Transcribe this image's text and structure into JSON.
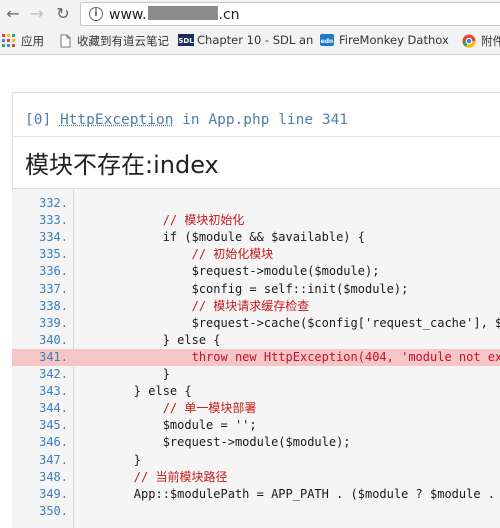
{
  "browser": {
    "url_prefix": "www.",
    "url_suffix": ".cn",
    "bookmarks": [
      {
        "label": "应用",
        "icon": "apps-grid-icon"
      },
      {
        "label": "收藏到有道云笔记",
        "icon": "page-icon"
      },
      {
        "label": "Chapter 10 - SDL an",
        "icon": "sdl-icon"
      },
      {
        "label": "FireMonkey Dathox",
        "icon": "edn-icon"
      },
      {
        "label": "附件",
        "icon": "chrome-icon"
      }
    ]
  },
  "exception": {
    "index": "[0]",
    "class": "HttpException",
    "location": "in App.php line 341",
    "message": "模块不存在:index"
  },
  "code_lines": [
    {
      "n": "332.",
      "text": ""
    },
    {
      "n": "333.",
      "text": "            // 模块初始化"
    },
    {
      "n": "334.",
      "text": "            if ($module && $available) {"
    },
    {
      "n": "335.",
      "text": "                // 初始化模块"
    },
    {
      "n": "336.",
      "text": "                $request->module($module);"
    },
    {
      "n": "337.",
      "text": "                $config = self::init($module);"
    },
    {
      "n": "338.",
      "text": "                // 模块请求缓存检查"
    },
    {
      "n": "339.",
      "text": "                $request->cache($config['request_cache'], $"
    },
    {
      "n": "340.",
      "text": "            } else {"
    },
    {
      "n": "341.",
      "text": "                throw new HttpException(404, 'module not ex"
    },
    {
      "n": "342.",
      "text": "            }"
    },
    {
      "n": "343.",
      "text": "        } else {"
    },
    {
      "n": "344.",
      "text": "            // 单一模块部署"
    },
    {
      "n": "345.",
      "text": "            $module = '';"
    },
    {
      "n": "346.",
      "text": "            $request->module($module);"
    },
    {
      "n": "347.",
      "text": "        }"
    },
    {
      "n": "348.",
      "text": "        // 当前模块路径"
    },
    {
      "n": "349.",
      "text": "        App::$modulePath = APP_PATH . ($module ? $module ."
    },
    {
      "n": "350.",
      "text": ""
    }
  ],
  "highlight_line": "341."
}
